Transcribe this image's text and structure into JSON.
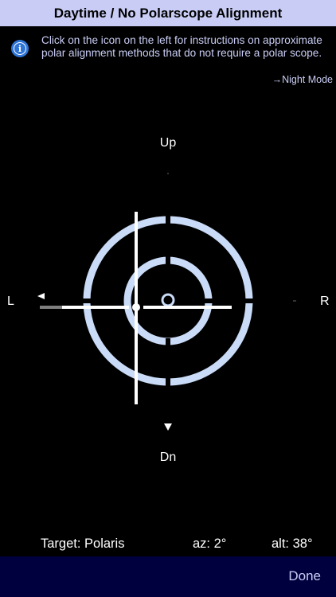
{
  "header": {
    "title": "Daytime / No Polarscope Alignment"
  },
  "info": {
    "icon": "info-icon",
    "text": "Click on the icon on the left for instructions on approximate polar alignment methods that do not require a polar scope."
  },
  "night_mode": {
    "label": "→Night Mode"
  },
  "directions": {
    "up": "Up",
    "down": "Dn",
    "left": "L",
    "right": "R"
  },
  "status": {
    "target": "Target: Polaris",
    "az": "az: 2°",
    "alt": "alt: 38°"
  },
  "footer": {
    "done_label": "Done"
  },
  "colors": {
    "title_bar": "#c9cdf5",
    "ring": "#c9dbf7",
    "accent_text": "#c9cdf5",
    "info_icon": "#2e74d6",
    "bottom_bar": "#00003e"
  }
}
